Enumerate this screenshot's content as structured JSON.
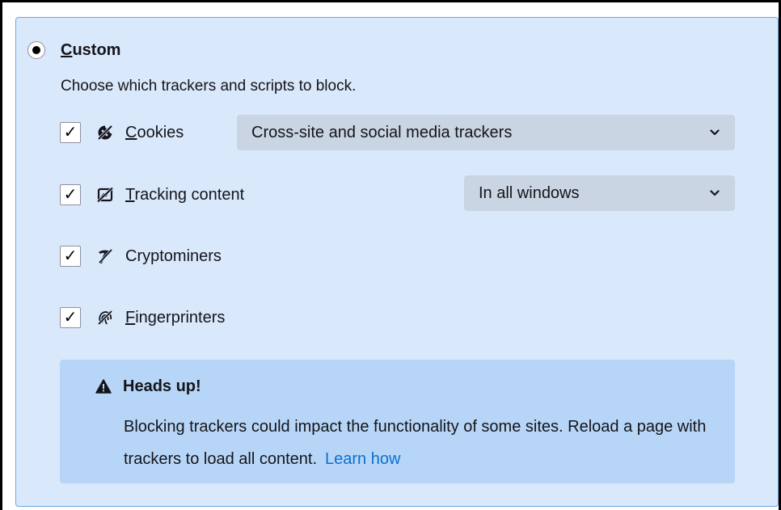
{
  "custom": {
    "label_underlined": "C",
    "label_rest": "ustom",
    "description": "Choose which trackers and scripts to block.",
    "selected": true
  },
  "trackers": [
    {
      "label_underlined": "C",
      "label_rest": "ookies",
      "checked": true,
      "check_glyph": "✓",
      "icon": "cookie-icon",
      "select_value": "Cross-site and social media trackers"
    },
    {
      "label_underlined": "T",
      "label_rest": "racking content",
      "checked": true,
      "check_glyph": "✓",
      "icon": "tracking-content-icon",
      "select_value": "In all windows"
    },
    {
      "label_underlined": "",
      "label_rest": "Cryptominers",
      "checked": true,
      "check_glyph": "✓",
      "icon": "cryptominer-icon"
    },
    {
      "label_underlined": "F",
      "label_rest": "ingerprinters",
      "checked": true,
      "check_glyph": "✓",
      "icon": "fingerprinter-icon"
    }
  ],
  "warning": {
    "title": "Heads up!",
    "body": "Blocking trackers could impact the functionality of some sites. Reload a page with trackers to load all content.",
    "link": "Learn how",
    "icon": "warning-icon"
  },
  "colors": {
    "panel_bg": "#d9e8fb",
    "panel_border": "#6aa7e0",
    "select_bg": "#c9d5e3",
    "warning_bg": "#b7d6f7",
    "link": "#0b6fd0"
  }
}
